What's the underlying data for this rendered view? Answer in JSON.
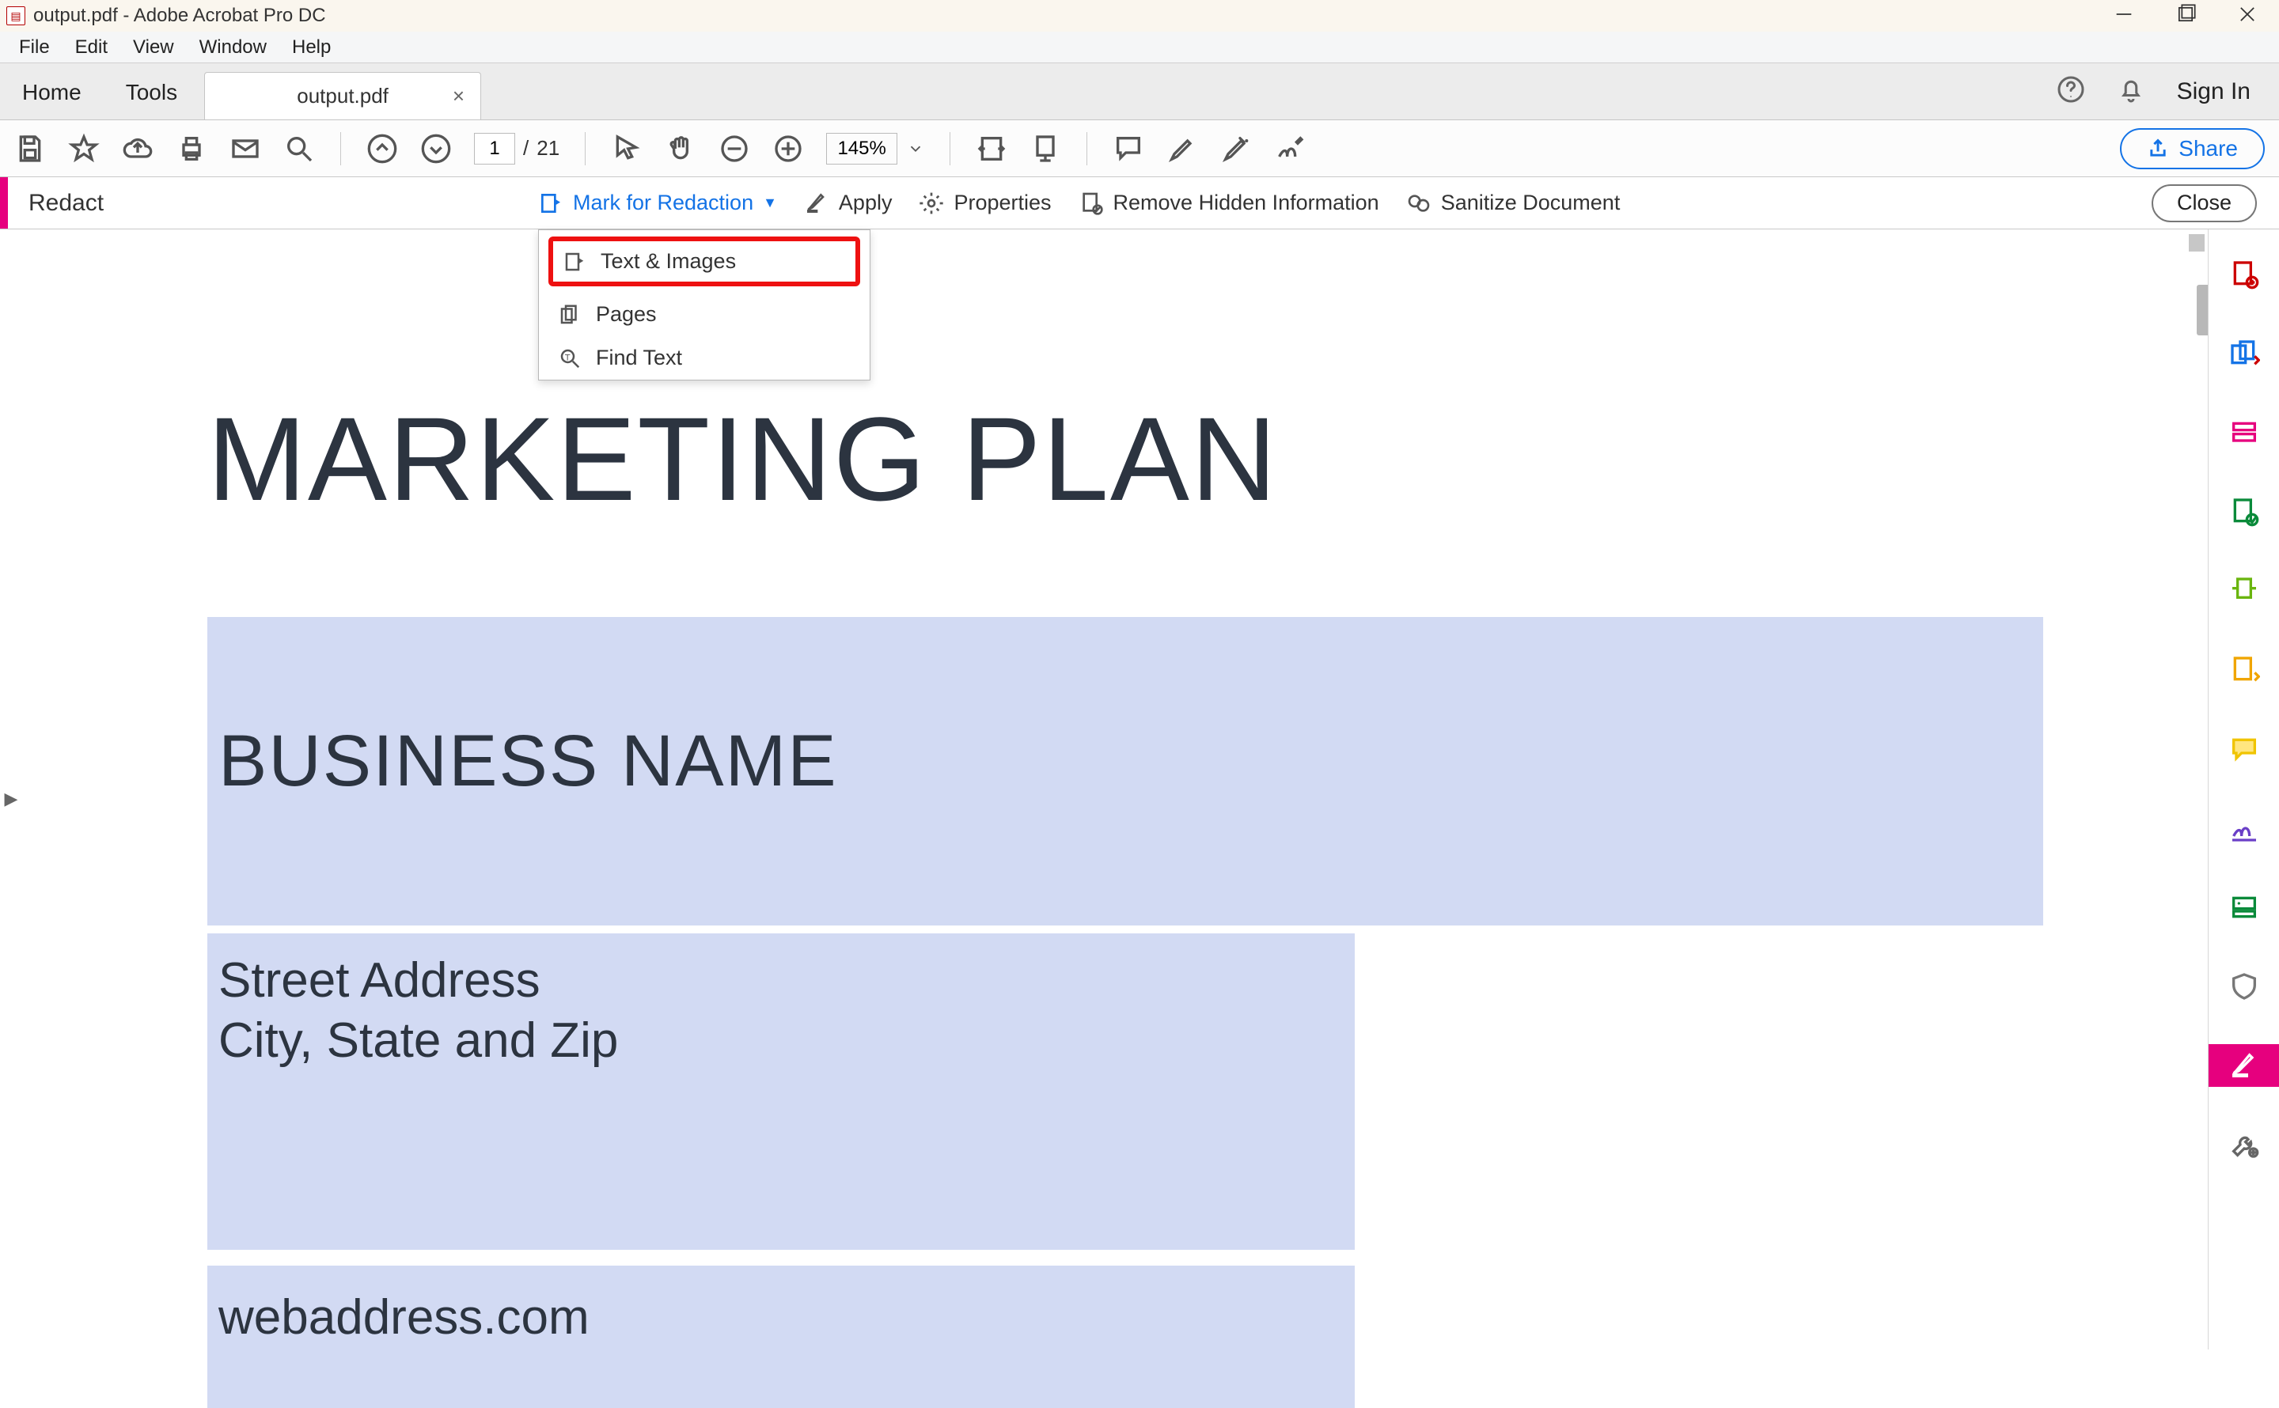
{
  "window": {
    "title": "output.pdf - Adobe Acrobat Pro DC"
  },
  "menu": {
    "file": "File",
    "edit": "Edit",
    "view": "View",
    "window": "Window",
    "help": "Help"
  },
  "tabs": {
    "home": "Home",
    "tools": "Tools",
    "doc": "output.pdf",
    "signin": "Sign In"
  },
  "toolbar": {
    "page_current": "1",
    "page_sep": "/",
    "page_total": "21",
    "zoom": "145%",
    "share": "Share"
  },
  "redact": {
    "label": "Redact",
    "mark": "Mark for Redaction",
    "apply": "Apply",
    "properties": "Properties",
    "remove_hidden": "Remove Hidden Information",
    "sanitize": "Sanitize Document",
    "close": "Close",
    "dd_text_images": "Text & Images",
    "dd_pages": "Pages",
    "dd_find": "Find Text"
  },
  "document": {
    "title": "MARKETING PLAN",
    "business": "BUSINESS NAME",
    "addr1": "Street Address",
    "addr2": "City, State and Zip",
    "web": "webaddress.com"
  }
}
